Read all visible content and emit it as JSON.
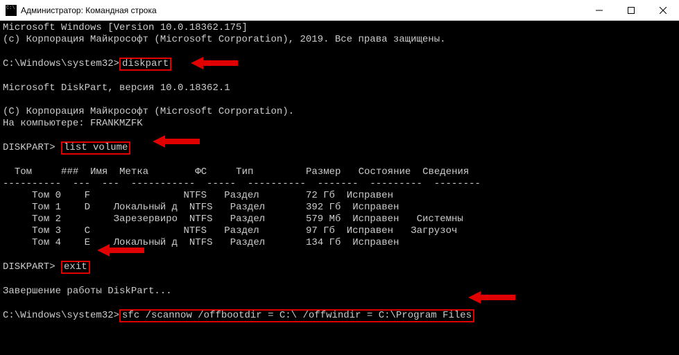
{
  "titlebar": {
    "title": "Администратор: Командная строка"
  },
  "header": {
    "line1": "Microsoft Windows [Version 10.0.18362.175]",
    "line2": "(с) Корпорация Майкрософт (Microsoft Corporation), 2019. Все права защищены."
  },
  "prompt1": {
    "path": "C:\\Windows\\system32>",
    "cmd": "diskpart"
  },
  "diskpart_info": {
    "line1": "Microsoft DiskPart, версия 10.0.18362.1",
    "line2": "(C) Корпорация Майкрософт (Microsoft Corporation).",
    "line3": "На компьютере: FRANKMZFK"
  },
  "prompt2": {
    "path": "DISKPART> ",
    "cmd": "list volume"
  },
  "table": {
    "headers": {
      "tom": "Том",
      "num": "###",
      "imya": "Имя",
      "metka": "Метка",
      "fs": "ФС",
      "tip": "Тип",
      "razmer": "Размер",
      "sostoyanie": "Состояние",
      "svedeniya": "Сведения"
    },
    "rows": [
      {
        "tom": "Том 0",
        "imya": "F",
        "metka": "",
        "fs": "NTFS",
        "tip": "Раздел",
        "razmer": "72 Гб",
        "sost": "Исправен",
        "sved": ""
      },
      {
        "tom": "Том 1",
        "imya": "D",
        "metka": "Локальный д",
        "fs": "NTFS",
        "tip": "Раздел",
        "razmer": "392 Гб",
        "sost": "Исправен",
        "sved": ""
      },
      {
        "tom": "Том 2",
        "imya": "",
        "metka": "Зарезервиро",
        "fs": "NTFS",
        "tip": "Раздел",
        "razmer": "579 Мб",
        "sost": "Исправен",
        "sved": "Системны"
      },
      {
        "tom": "Том 3",
        "imya": "C",
        "metka": "",
        "fs": "NTFS",
        "tip": "Раздел",
        "razmer": "97 Гб",
        "sost": "Исправен",
        "sved": "Загрузоч"
      },
      {
        "tom": "Том 4",
        "imya": "E",
        "metka": "Локальный д",
        "fs": "NTFS",
        "tip": "Раздел",
        "razmer": "134 Гб",
        "sost": "Исправен",
        "sved": ""
      }
    ]
  },
  "prompt3": {
    "path": "DISKPART> ",
    "cmd": "exit"
  },
  "diskpart_exit": "Завершение работы DiskPart...",
  "prompt4": {
    "path": "C:\\Windows\\system32>",
    "cmd": "sfc /scannow /offbootdir = C:\\ /offwindir = C:\\Program Files"
  },
  "separator": "----------  ---  ---  -----------  -----  ----------  -------  ---------  --------"
}
